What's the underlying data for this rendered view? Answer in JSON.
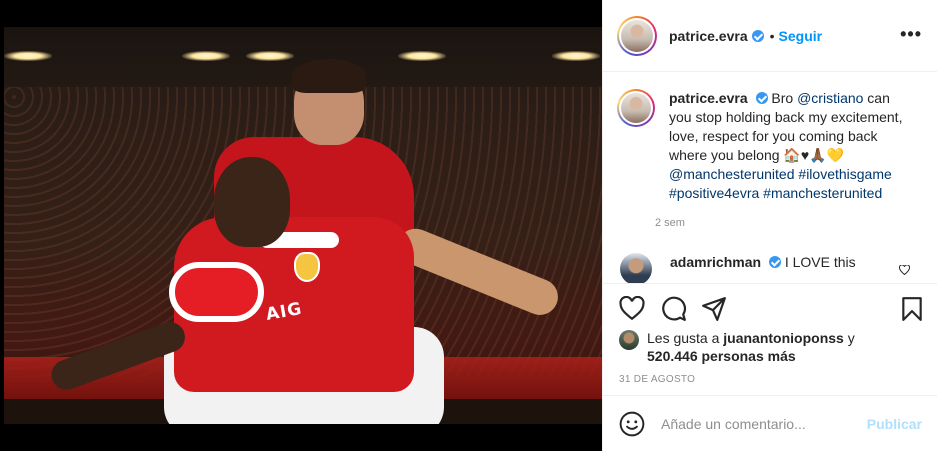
{
  "post": {
    "username": "patrice.evra",
    "dot": "•",
    "follow_label": "Seguir",
    "more_label": "•••"
  },
  "caption": {
    "username": "patrice.evra",
    "text_before_mention": " Bro ",
    "mention": "@cristiano",
    "text_after_mention": " can you stop holding back my excitement, love, respect for you coming back where you belong 🏠♥🙏🏾💛 ",
    "tags": [
      "@manchesterunited",
      "#ilovethisgame",
      "#positive4evra",
      "#manchesterunited"
    ],
    "time": "2 sem"
  },
  "reply": {
    "username": "adamrichman",
    "text": " I LOVE this"
  },
  "likes": {
    "prefix": "Les gusta a ",
    "liker": "juanantonioponss",
    "suffix": " y",
    "others": "520.446 personas más"
  },
  "date": "31 DE AGOSTO",
  "composer": {
    "placeholder": "Añade un comentario...",
    "post_label": "Publicar"
  },
  "photo": {
    "sponsor_text": "AIG"
  }
}
